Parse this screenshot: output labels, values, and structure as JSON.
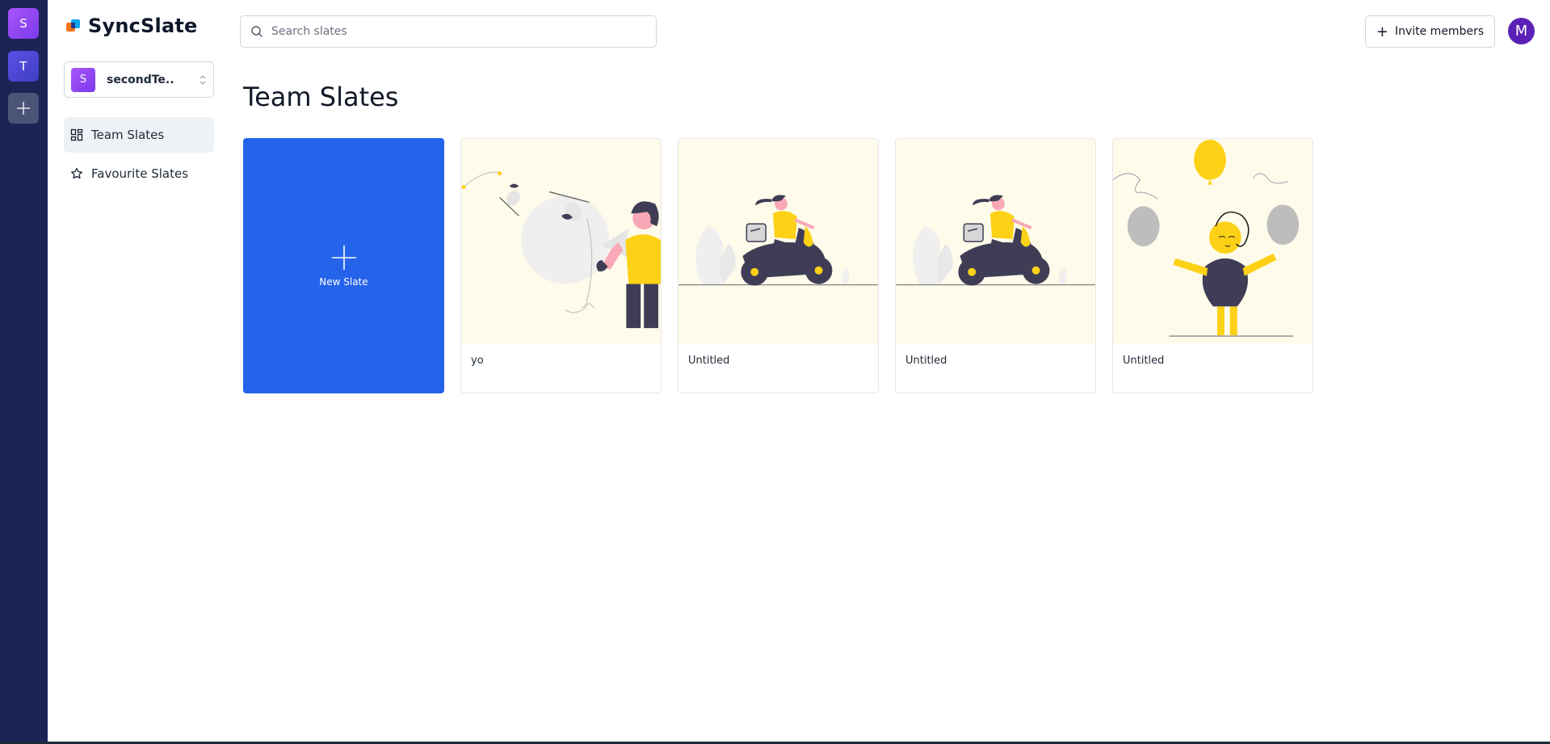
{
  "app": {
    "name": "SyncSlate"
  },
  "rail": {
    "teams": [
      {
        "initial": "S"
      },
      {
        "initial": "T"
      }
    ]
  },
  "team_switcher": {
    "initial": "S",
    "name": "secondTe..."
  },
  "nav": [
    {
      "label": "Team Slates",
      "icon": "grid-icon",
      "active": true
    },
    {
      "label": "Favourite Slates",
      "icon": "star-icon",
      "active": false
    }
  ],
  "search": {
    "placeholder": "Search slates",
    "value": ""
  },
  "header": {
    "invite_label": "Invite members",
    "user_initial": "M"
  },
  "page": {
    "title": "Team Slates"
  },
  "new_slate": {
    "label": "New Slate"
  },
  "slates": [
    {
      "title": "yo",
      "illustration": "fishing-woman"
    },
    {
      "title": "Untitled",
      "illustration": "scooter-delivery"
    },
    {
      "title": "Untitled",
      "illustration": "scooter-delivery"
    },
    {
      "title": "Untitled",
      "illustration": "balloons-person"
    }
  ],
  "colors": {
    "rail": "#1b2455",
    "accent": "#2563eb",
    "thumb_bg": "#fffbea",
    "yellow": "#fcd116"
  }
}
